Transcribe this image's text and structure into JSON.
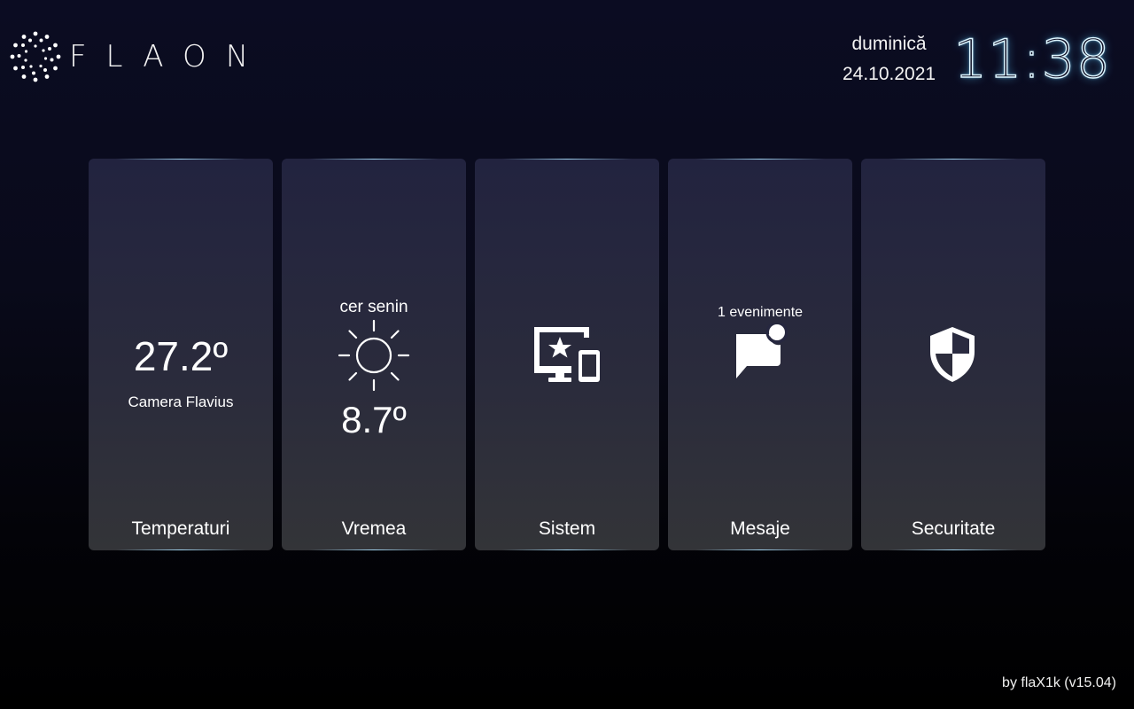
{
  "header": {
    "logo_text": "FLAON",
    "day": "duminică",
    "date": "24.10.2021",
    "time": "11:38"
  },
  "tiles": [
    {
      "label": "Temperaturi",
      "value": "27.2º",
      "room": "Camera Flavius"
    },
    {
      "label": "Vremea",
      "description": "cer senin",
      "icon": "sun-icon",
      "value": "8.7º"
    },
    {
      "label": "Sistem",
      "icon": "devices-star-icon"
    },
    {
      "label": "Mesaje",
      "events": "1 evenimente",
      "icon": "chat-notification-icon"
    },
    {
      "label": "Securitate",
      "icon": "shield-icon"
    }
  ],
  "footer": {
    "credit": "by flaX1k (v15.04)"
  },
  "colors": {
    "background": "#0b0c22",
    "tile_top": "#22233f",
    "tile_bottom": "#333438",
    "clock_glow": "#5ac8ff",
    "text": "#ffffff"
  }
}
